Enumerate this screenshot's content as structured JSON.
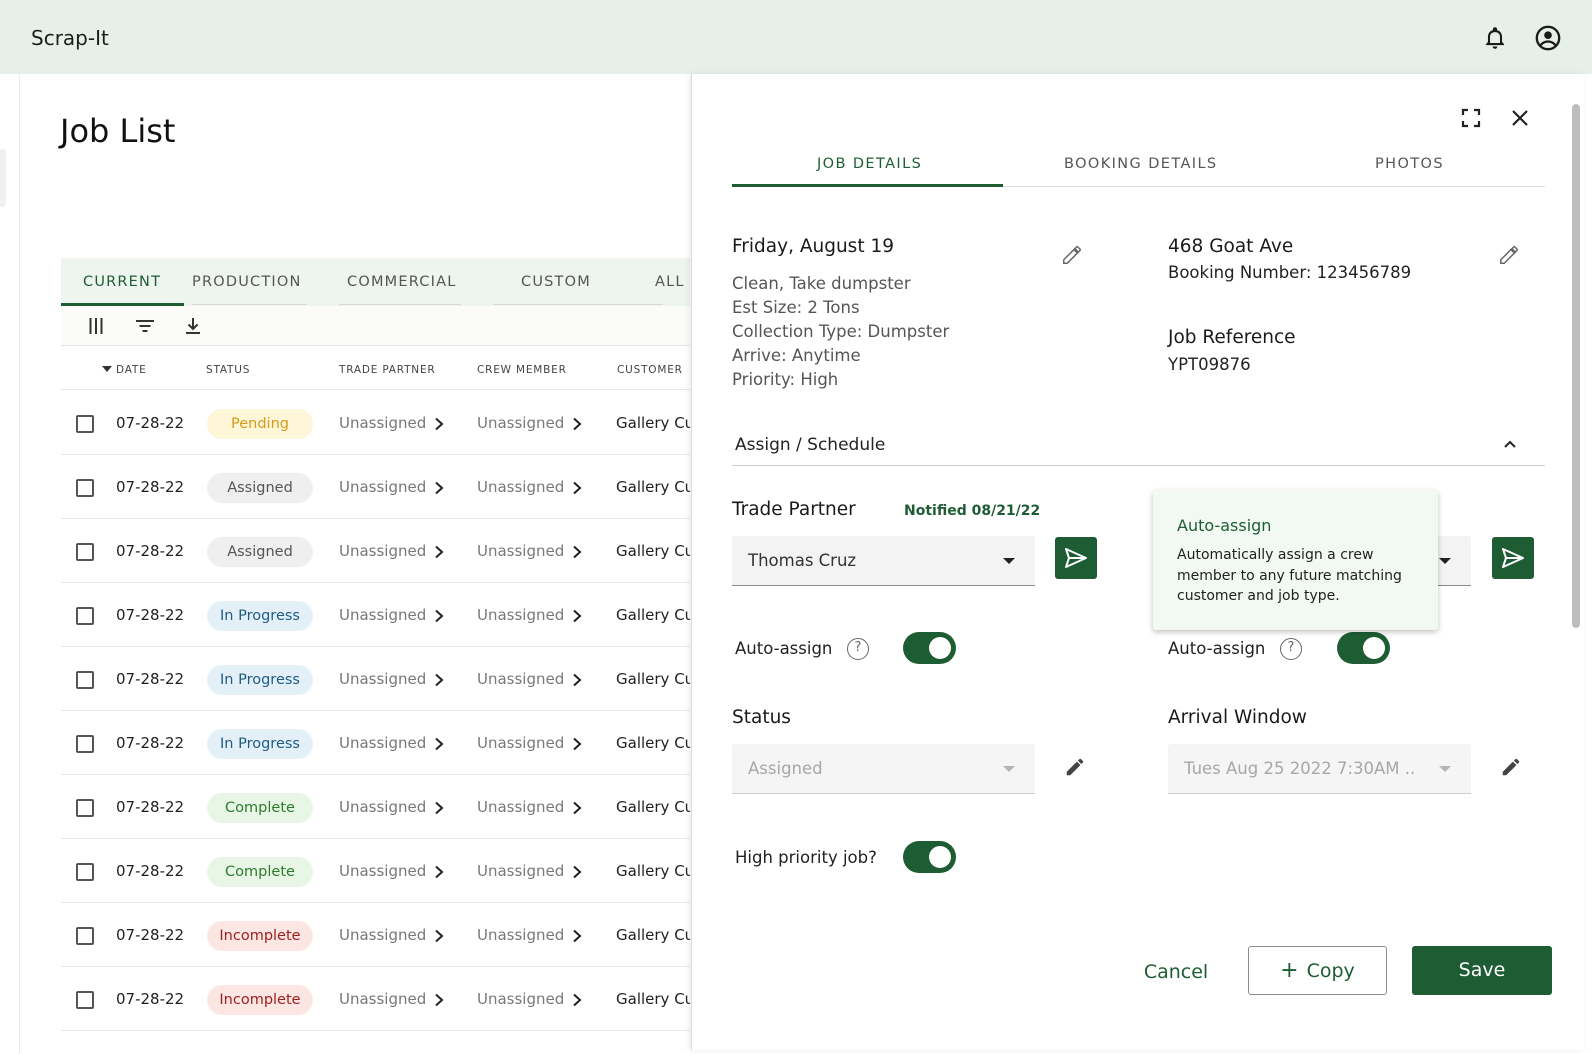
{
  "app": {
    "brand": "Scrap-It"
  },
  "header": {
    "notifications_icon": "bell-icon",
    "account_icon": "account-circle-icon"
  },
  "job_list": {
    "title": "Job List",
    "tabs": [
      "CURRENT",
      "PRODUCTION",
      "COMMERCIAL",
      "CUSTOM",
      "ALL"
    ],
    "active_tab": "CURRENT",
    "toolbar_icons": [
      "columns-icon",
      "filter-icon",
      "download-icon"
    ],
    "columns": [
      "DATE",
      "STATUS",
      "TRADE PARTNER",
      "CREW MEMBER",
      "CUSTOMER"
    ],
    "rows": [
      {
        "date": "07-28-22",
        "status": "Pending",
        "status_kind": "pending",
        "trade_partner": "Unassigned",
        "crew_member": "Unassigned",
        "customer": "Gallery Cu"
      },
      {
        "date": "07-28-22",
        "status": "Assigned",
        "status_kind": "assigned",
        "trade_partner": "Unassigned",
        "crew_member": "Unassigned",
        "customer": "Gallery Cu"
      },
      {
        "date": "07-28-22",
        "status": "Assigned",
        "status_kind": "assigned",
        "trade_partner": "Unassigned",
        "crew_member": "Unassigned",
        "customer": "Gallery Cu"
      },
      {
        "date": "07-28-22",
        "status": "In Progress",
        "status_kind": "inprogress",
        "trade_partner": "Unassigned",
        "crew_member": "Unassigned",
        "customer": "Gallery Cu"
      },
      {
        "date": "07-28-22",
        "status": "In Progress",
        "status_kind": "inprogress",
        "trade_partner": "Unassigned",
        "crew_member": "Unassigned",
        "customer": "Gallery Cu"
      },
      {
        "date": "07-28-22",
        "status": "In Progress",
        "status_kind": "inprogress",
        "trade_partner": "Unassigned",
        "crew_member": "Unassigned",
        "customer": "Gallery Cu"
      },
      {
        "date": "07-28-22",
        "status": "Complete",
        "status_kind": "complete",
        "trade_partner": "Unassigned",
        "crew_member": "Unassigned",
        "customer": "Gallery Cu"
      },
      {
        "date": "07-28-22",
        "status": "Complete",
        "status_kind": "complete",
        "trade_partner": "Unassigned",
        "crew_member": "Unassigned",
        "customer": "Gallery Cu"
      },
      {
        "date": "07-28-22",
        "status": "Incomplete",
        "status_kind": "incomplete",
        "trade_partner": "Unassigned",
        "crew_member": "Unassigned",
        "customer": "Gallery Cu"
      },
      {
        "date": "07-28-22",
        "status": "Incomplete",
        "status_kind": "incomplete",
        "trade_partner": "Unassigned",
        "crew_member": "Unassigned",
        "customer": "Gallery Cu"
      }
    ]
  },
  "drawer": {
    "tabs": [
      "JOB DETAILS",
      "BOOKING DETAILS",
      "PHOTOS"
    ],
    "active_tab": "JOB DETAILS",
    "job": {
      "date": "Friday, August 19",
      "details": [
        "Clean, Take dumpster",
        "Est Size: 2 Tons",
        "Collection Type: Dumpster",
        "Arrive: Anytime",
        "Priority: High"
      ]
    },
    "address": "468 Goat Ave",
    "booking_number": "Booking Number: 123456789",
    "job_reference_label": "Job Reference",
    "job_reference": "YPT09876",
    "assign_section": "Assign / Schedule",
    "trade_partner": {
      "label": "Trade Partner",
      "notified": "Notified 08/21/22",
      "value": "Thomas Cruz"
    },
    "auto_assign_label": "Auto-assign",
    "tooltip": {
      "title": "Auto-assign",
      "body": "Automatically assign a crew member to any future matching customer and job type."
    },
    "status": {
      "label": "Status",
      "value": "Assigned"
    },
    "arrival_window": {
      "label": "Arrival Window",
      "value": "Tues Aug 25 2022 7:30AM .."
    },
    "high_priority_label": "High priority job?",
    "toggles": {
      "auto_assign_trade": true,
      "auto_assign_crew": true,
      "high_priority": true
    },
    "buttons": {
      "cancel": "Cancel",
      "copy": "Copy",
      "copy_icon": "+",
      "save": "Save"
    }
  },
  "colors": {
    "brand_green": "#1e5d33",
    "topbar_bg": "#e7f0e8"
  }
}
